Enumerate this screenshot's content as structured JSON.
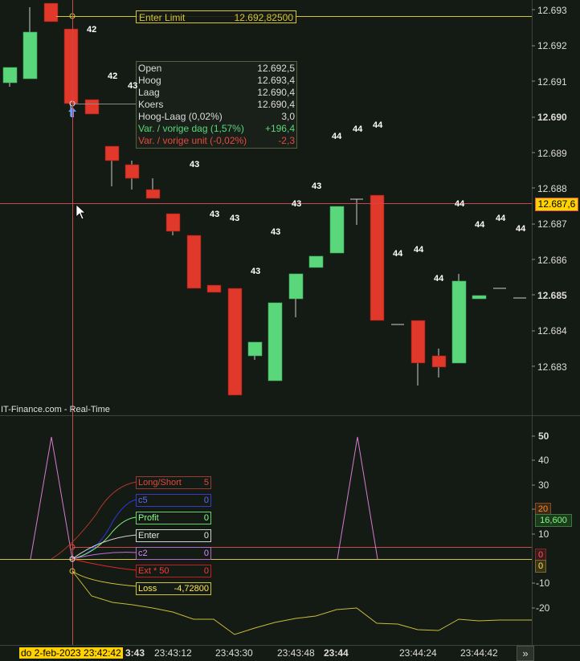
{
  "colors": {
    "bg": "#141a14",
    "up": "#5ad77a",
    "down": "#e0382a",
    "enter": "#d6c336",
    "cross": "#c94a4a",
    "grid": "#2a332a"
  },
  "enter_limit": {
    "label": "Enter Limit",
    "value": "12.692,82500"
  },
  "ohlc": {
    "open_label": "Open",
    "open": "12.692,5",
    "high_label": "Hoog",
    "high": "12.693,4",
    "low_label": "Laag",
    "low": "12.690,4",
    "close_label": "Koers",
    "close": "12.690,4",
    "range_label": "Hoog-Laag (0,02%)",
    "range": "3,0",
    "prevday_label": "Var. / vorige dag (1,57%)",
    "prevday": "+196,4",
    "prevunit_label": "Var. / vorige unit (-0,02%)",
    "prevunit": "-2,3"
  },
  "source_label": "IT-Finance.com - Real-Time",
  "price_axis": {
    "ticks": [
      "12.693",
      "12.692",
      "12.691",
      "12.690",
      "12.689",
      "12.688",
      "12.687",
      "12.686",
      "12.685",
      "12.684",
      "12.683"
    ],
    "current": "12.687,6"
  },
  "volume_labels": [
    "42",
    "42",
    "43",
    "43",
    "43",
    "43",
    "43",
    "43",
    "43",
    "44",
    "44",
    "44",
    "44",
    "44",
    "44",
    "44",
    "44",
    "44",
    "44"
  ],
  "indicator_axis": {
    "ticks": [
      "50",
      "40",
      "30",
      "20",
      "10",
      "-10",
      "-20"
    ],
    "marker_orange": "20",
    "marker_green": "16,600",
    "marker_red": "0",
    "marker_yellow": "0"
  },
  "indicators": [
    {
      "label": "Long/Short",
      "value": "5"
    },
    {
      "label": "c5",
      "value": "0"
    },
    {
      "label": "Profit",
      "value": "0"
    },
    {
      "label": "Enter",
      "value": "0"
    },
    {
      "label": "c2",
      "value": "0"
    },
    {
      "label": "Ext * 50",
      "value": "0"
    },
    {
      "label": "Loss",
      "value": "-4,72800"
    }
  ],
  "time_axis": {
    "cursor": "do 2-feb-2023 23:42:42",
    "ticks": [
      "3:43",
      "23:43:12",
      "23:43:30",
      "23:43:48",
      "23:44",
      "23:44:24",
      "23:44:42"
    ],
    "scroll": "»"
  }
}
